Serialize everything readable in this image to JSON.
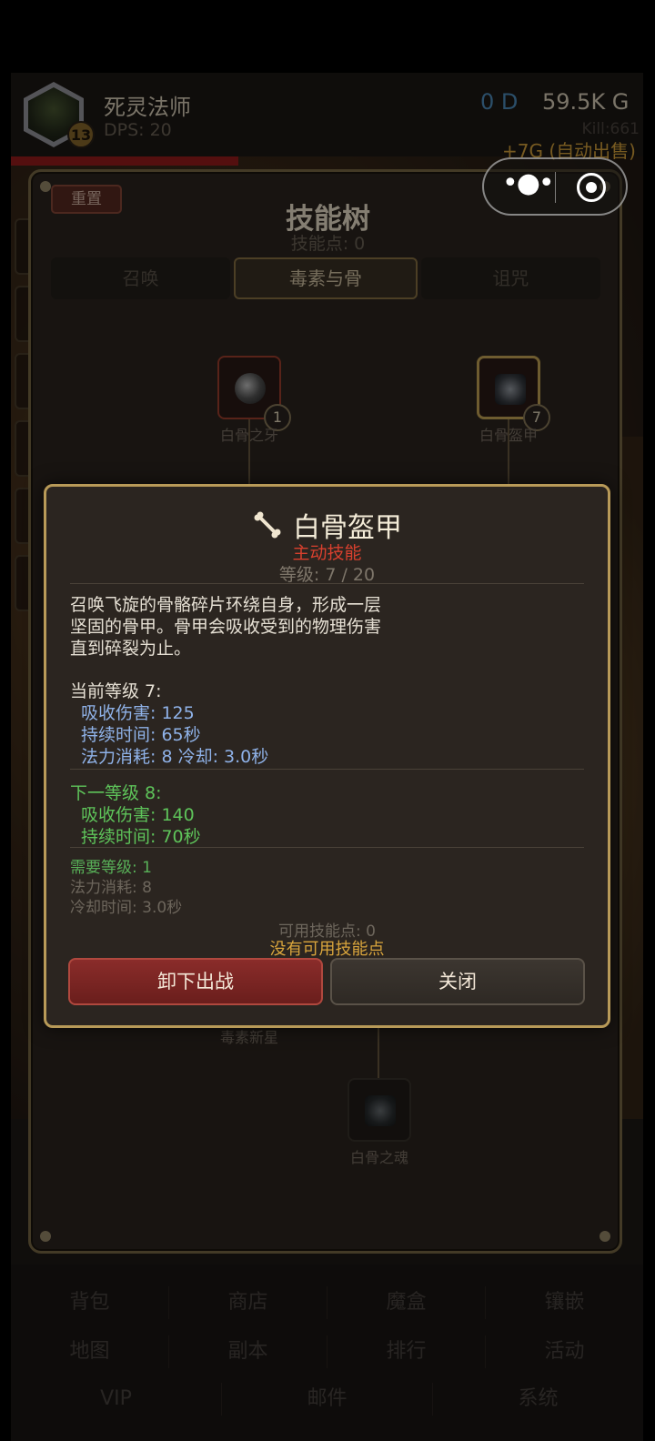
{
  "hud": {
    "character_name": "死灵法师",
    "level": "13",
    "dps": "DPS: 20",
    "diamonds": "0 D",
    "gold": "59.5K G",
    "kills": "Kill:661",
    "auto_sell": "+7G (自动出售)"
  },
  "skill_tree": {
    "reset_label": "重置",
    "title": "技能树",
    "points": "技能点: 0",
    "tabs": [
      {
        "label": "召唤",
        "active": false
      },
      {
        "label": "毒素与骨",
        "active": true
      },
      {
        "label": "诅咒",
        "active": false
      }
    ],
    "nodes": [
      {
        "label": "白骨之牙",
        "count": "1"
      },
      {
        "label": "白骨盔甲",
        "count": "7"
      },
      {
        "label": "毒素新星",
        "count": ""
      },
      {
        "label": "白骨之魂",
        "count": ""
      }
    ]
  },
  "skill_detail": {
    "name": "白骨盔甲",
    "type": "主动技能",
    "level": "等级: 7 / 20",
    "description": [
      "召唤飞旋的骨骼碎片环绕自身，形成一层",
      "坚固的骨甲。骨甲会吸收受到的物理伤害",
      "直到碎裂为止。"
    ],
    "current_header": "当前等级 7:",
    "current_stats": [
      "吸收伤害: 125",
      "持续时间: 65秒",
      "法力消耗: 8  冷却: 3.0秒"
    ],
    "next_header": "下一等级 8:",
    "next_stats": [
      "吸收伤害: 140",
      "持续时间: 70秒"
    ],
    "req_level": "需要等级: 1",
    "mana_cost": "法力消耗: 8",
    "cooldown": "冷却时间: 3.0秒",
    "available_points": "可用技能点: 0",
    "no_points": "没有可用技能点",
    "unequip_label": "卸下出战",
    "close_label": "关闭"
  },
  "bottom_nav": {
    "row1": [
      "背包",
      "商店",
      "魔盒",
      "镶嵌"
    ],
    "row2": [
      "地图",
      "副本",
      "排行",
      "活动"
    ],
    "row3": [
      "VIP",
      "邮件",
      "系统"
    ]
  },
  "colors": {
    "accent_gold": "#b89a58",
    "active_red": "#d8402e",
    "current_blue": "#8fb2e8",
    "next_green": "#5ec45a",
    "warning_gold": "#d9a53c"
  },
  "icons": [
    "more-icon",
    "close-target-icon",
    "bone-icon"
  ]
}
